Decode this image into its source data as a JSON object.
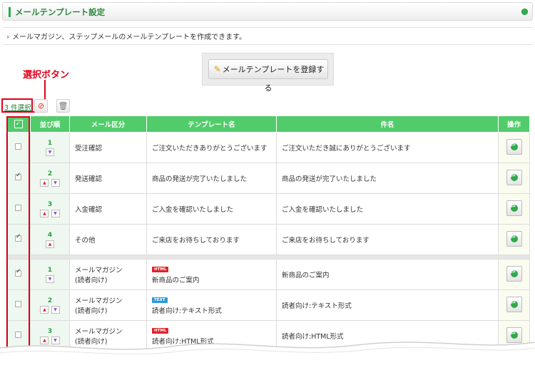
{
  "header": {
    "title": "メールテンプレート設定"
  },
  "description": "メールマガジン、ステップメールのメールテンプレートを作成できます。",
  "register_button": "メールテンプレートを登録する",
  "annotation": "選択ボタン",
  "toolbar": {
    "select_link": "3 件選択"
  },
  "table": {
    "headers": {
      "order": "並び順",
      "type": "メール区分",
      "template": "テンプレート名",
      "subject": "件名",
      "action": "操作"
    },
    "group1": [
      {
        "checked": false,
        "order": "1",
        "type": "受注確認",
        "template": "ご注文いただきありがとうございます",
        "subject": "ご注文いただき誠にありがとうございます"
      },
      {
        "checked": true,
        "order": "2",
        "type": "発送確認",
        "template": "商品の発送が完了いたしました",
        "subject": "商品の発送が完了いたしました"
      },
      {
        "checked": false,
        "order": "3",
        "type": "入金確認",
        "template": "ご入金を確認いたしました",
        "subject": "ご入金を確認いたしました"
      },
      {
        "checked": true,
        "order": "4",
        "type": "その他",
        "template": "ご来店をお待ちしております",
        "subject": "ご来店をお待ちしております"
      }
    ],
    "group2": [
      {
        "checked": true,
        "order": "1",
        "type1": "メールマガジン",
        "type2": "(読者向け)",
        "badge": "HTML",
        "template": "新商品のご案内",
        "subject": "新商品のご案内"
      },
      {
        "checked": false,
        "order": "2",
        "type1": "メールマガジン",
        "type2": "(読者向け)",
        "badge": "TEXT",
        "template": "読者向け:テキスト形式",
        "subject": "読者向け:テキスト形式"
      },
      {
        "checked": false,
        "order": "3",
        "type1": "メールマガジン",
        "type2": "(読者向け)",
        "badge": "HTML",
        "template": "読者向け:HTML形式",
        "subject": "読者向け:HTML形式"
      }
    ]
  },
  "colors": {
    "header_green": "#52cc6b",
    "accent_red": "#e0001b",
    "title_green": "#2c8a3e"
  }
}
